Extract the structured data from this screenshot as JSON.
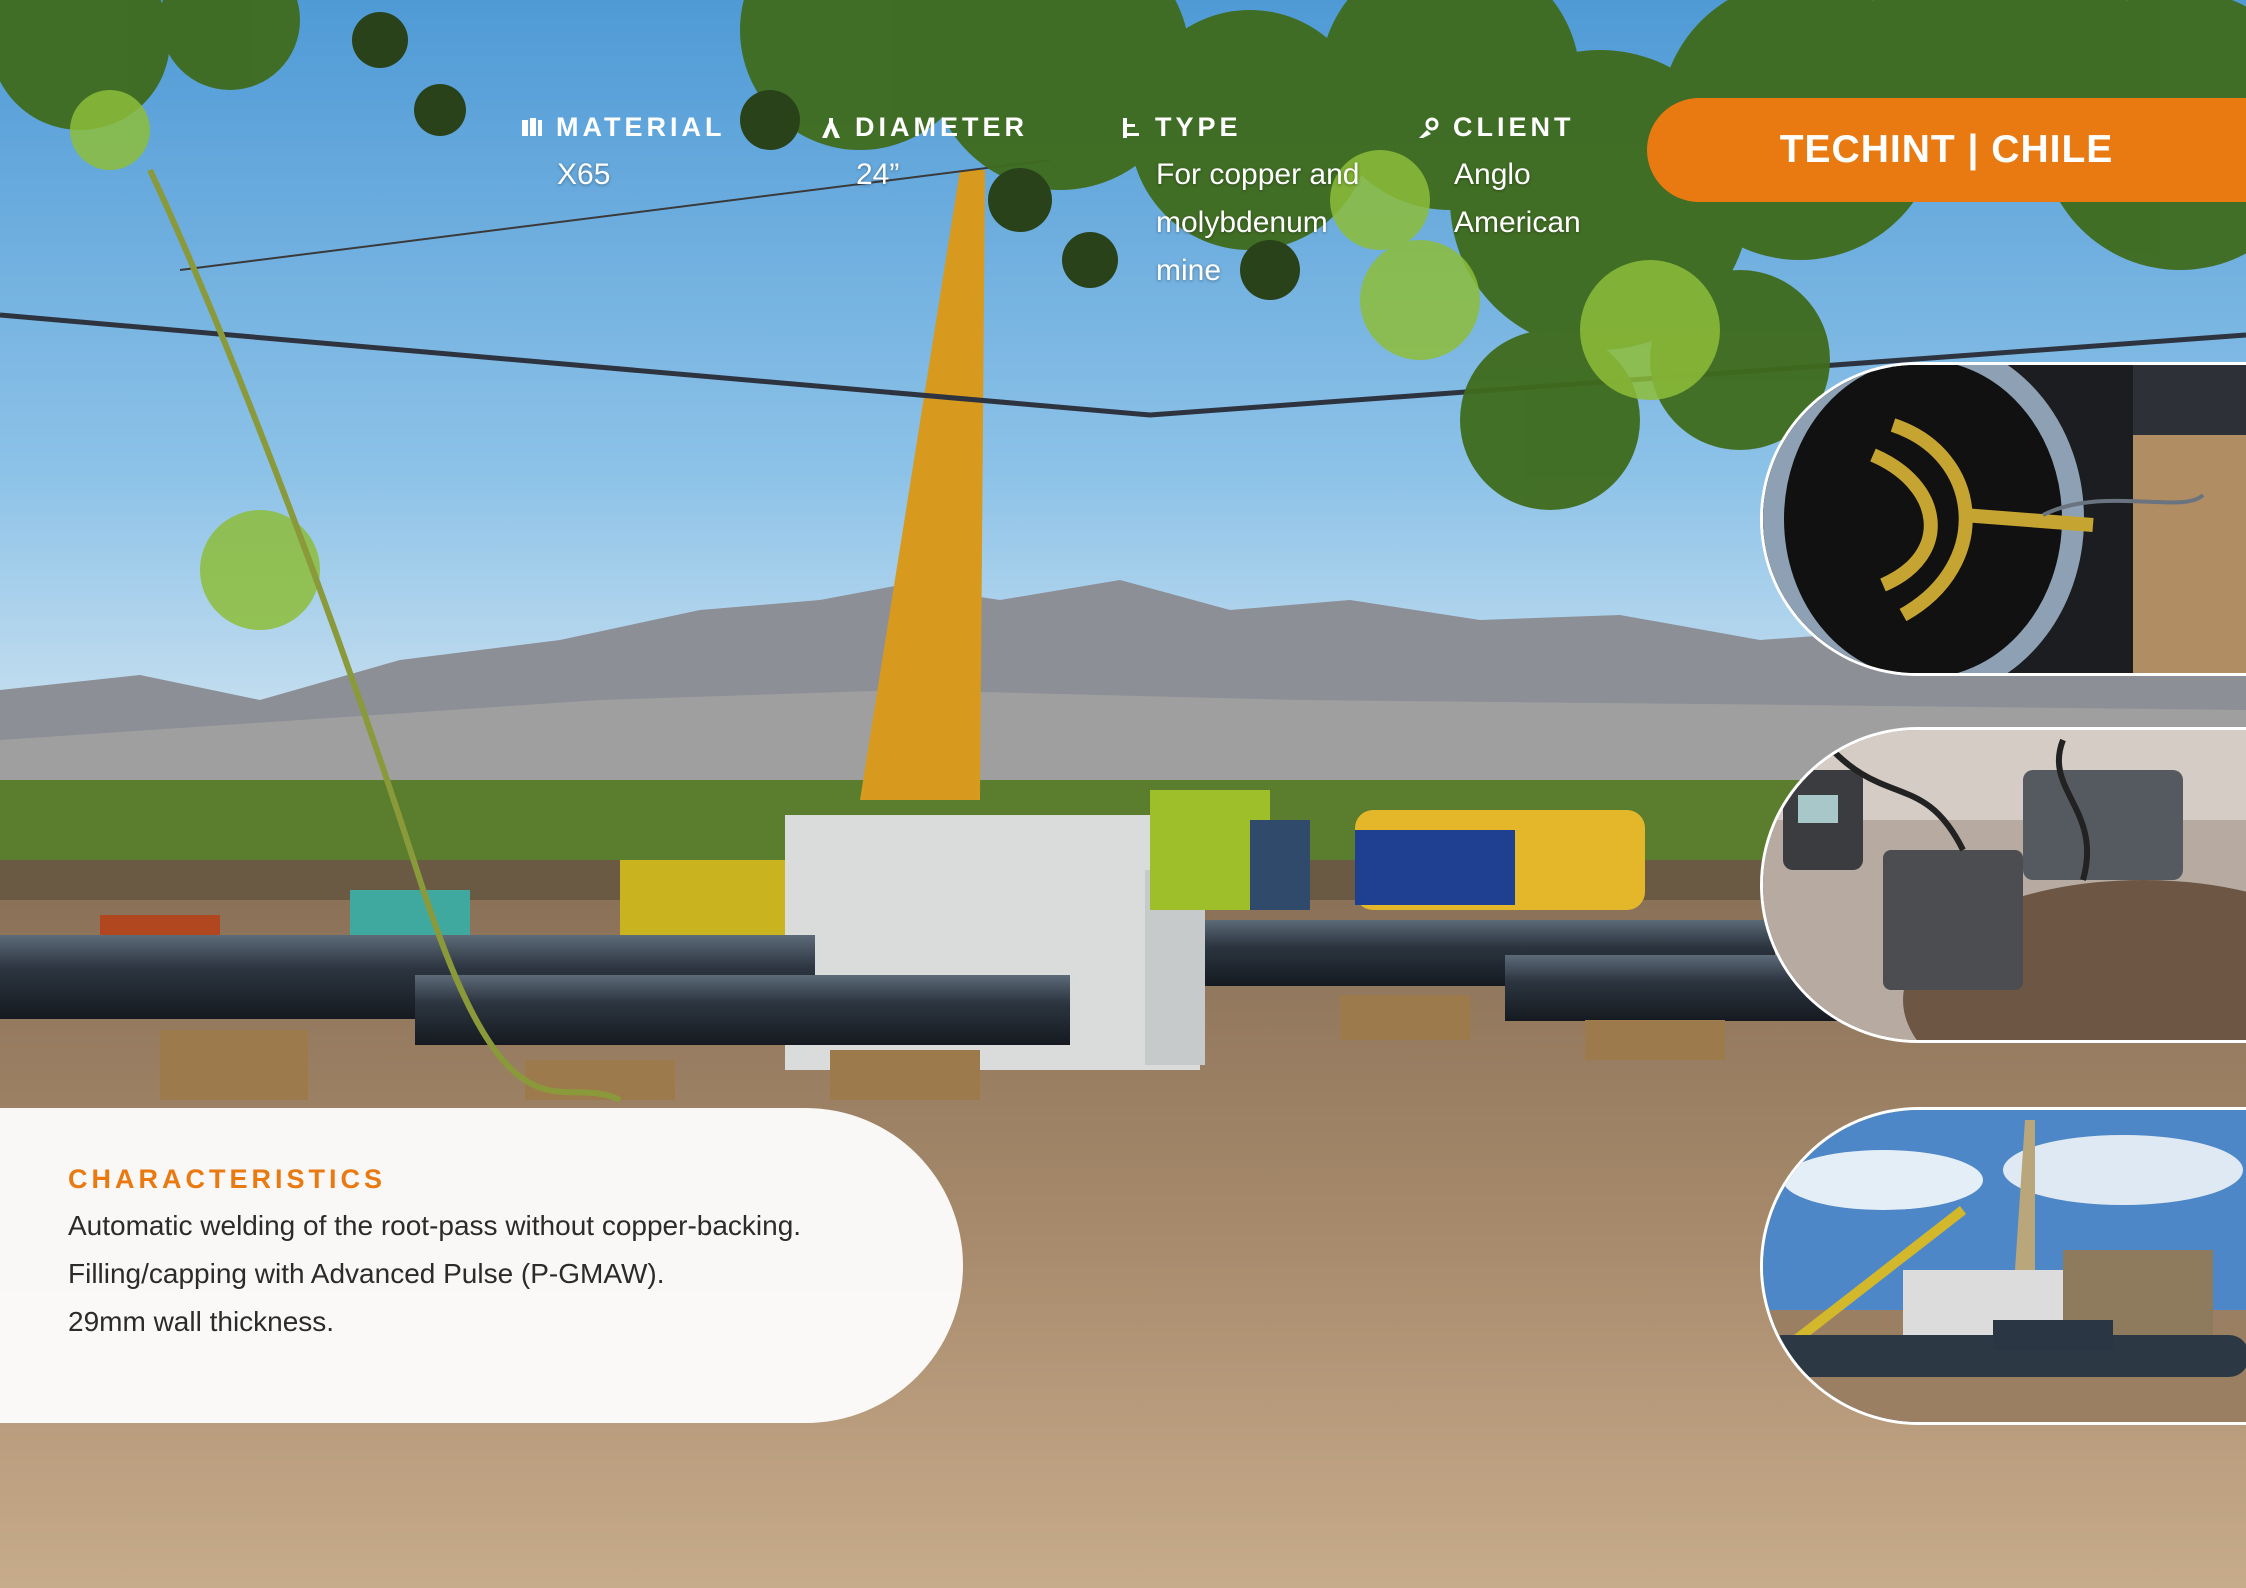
{
  "badge": {
    "text": "TECHINT | CHILE"
  },
  "specs": [
    {
      "label": "MATERIAL",
      "icon": "material-icon",
      "values": [
        "X65"
      ]
    },
    {
      "label": "DIAMETER",
      "icon": "diameter-icon",
      "values": [
        "24”"
      ]
    },
    {
      "label": "TYPE",
      "icon": "type-icon",
      "values": [
        "For copper and",
        "molybdenum",
        "mine"
      ]
    },
    {
      "label": "CLIENT",
      "icon": "client-icon",
      "values": [
        "Anglo",
        "American"
      ]
    }
  ],
  "characteristics": {
    "title": "CHARACTERISTICS",
    "lines": [
      "Automatic welding of the root-pass without copper-backing.",
      "Filling/capping with Advanced Pulse (P-GMAW).",
      "29mm wall thickness."
    ]
  },
  "colors": {
    "accent": "#e97a12",
    "sky": "#6fb1de",
    "soil": "#9b8062"
  }
}
